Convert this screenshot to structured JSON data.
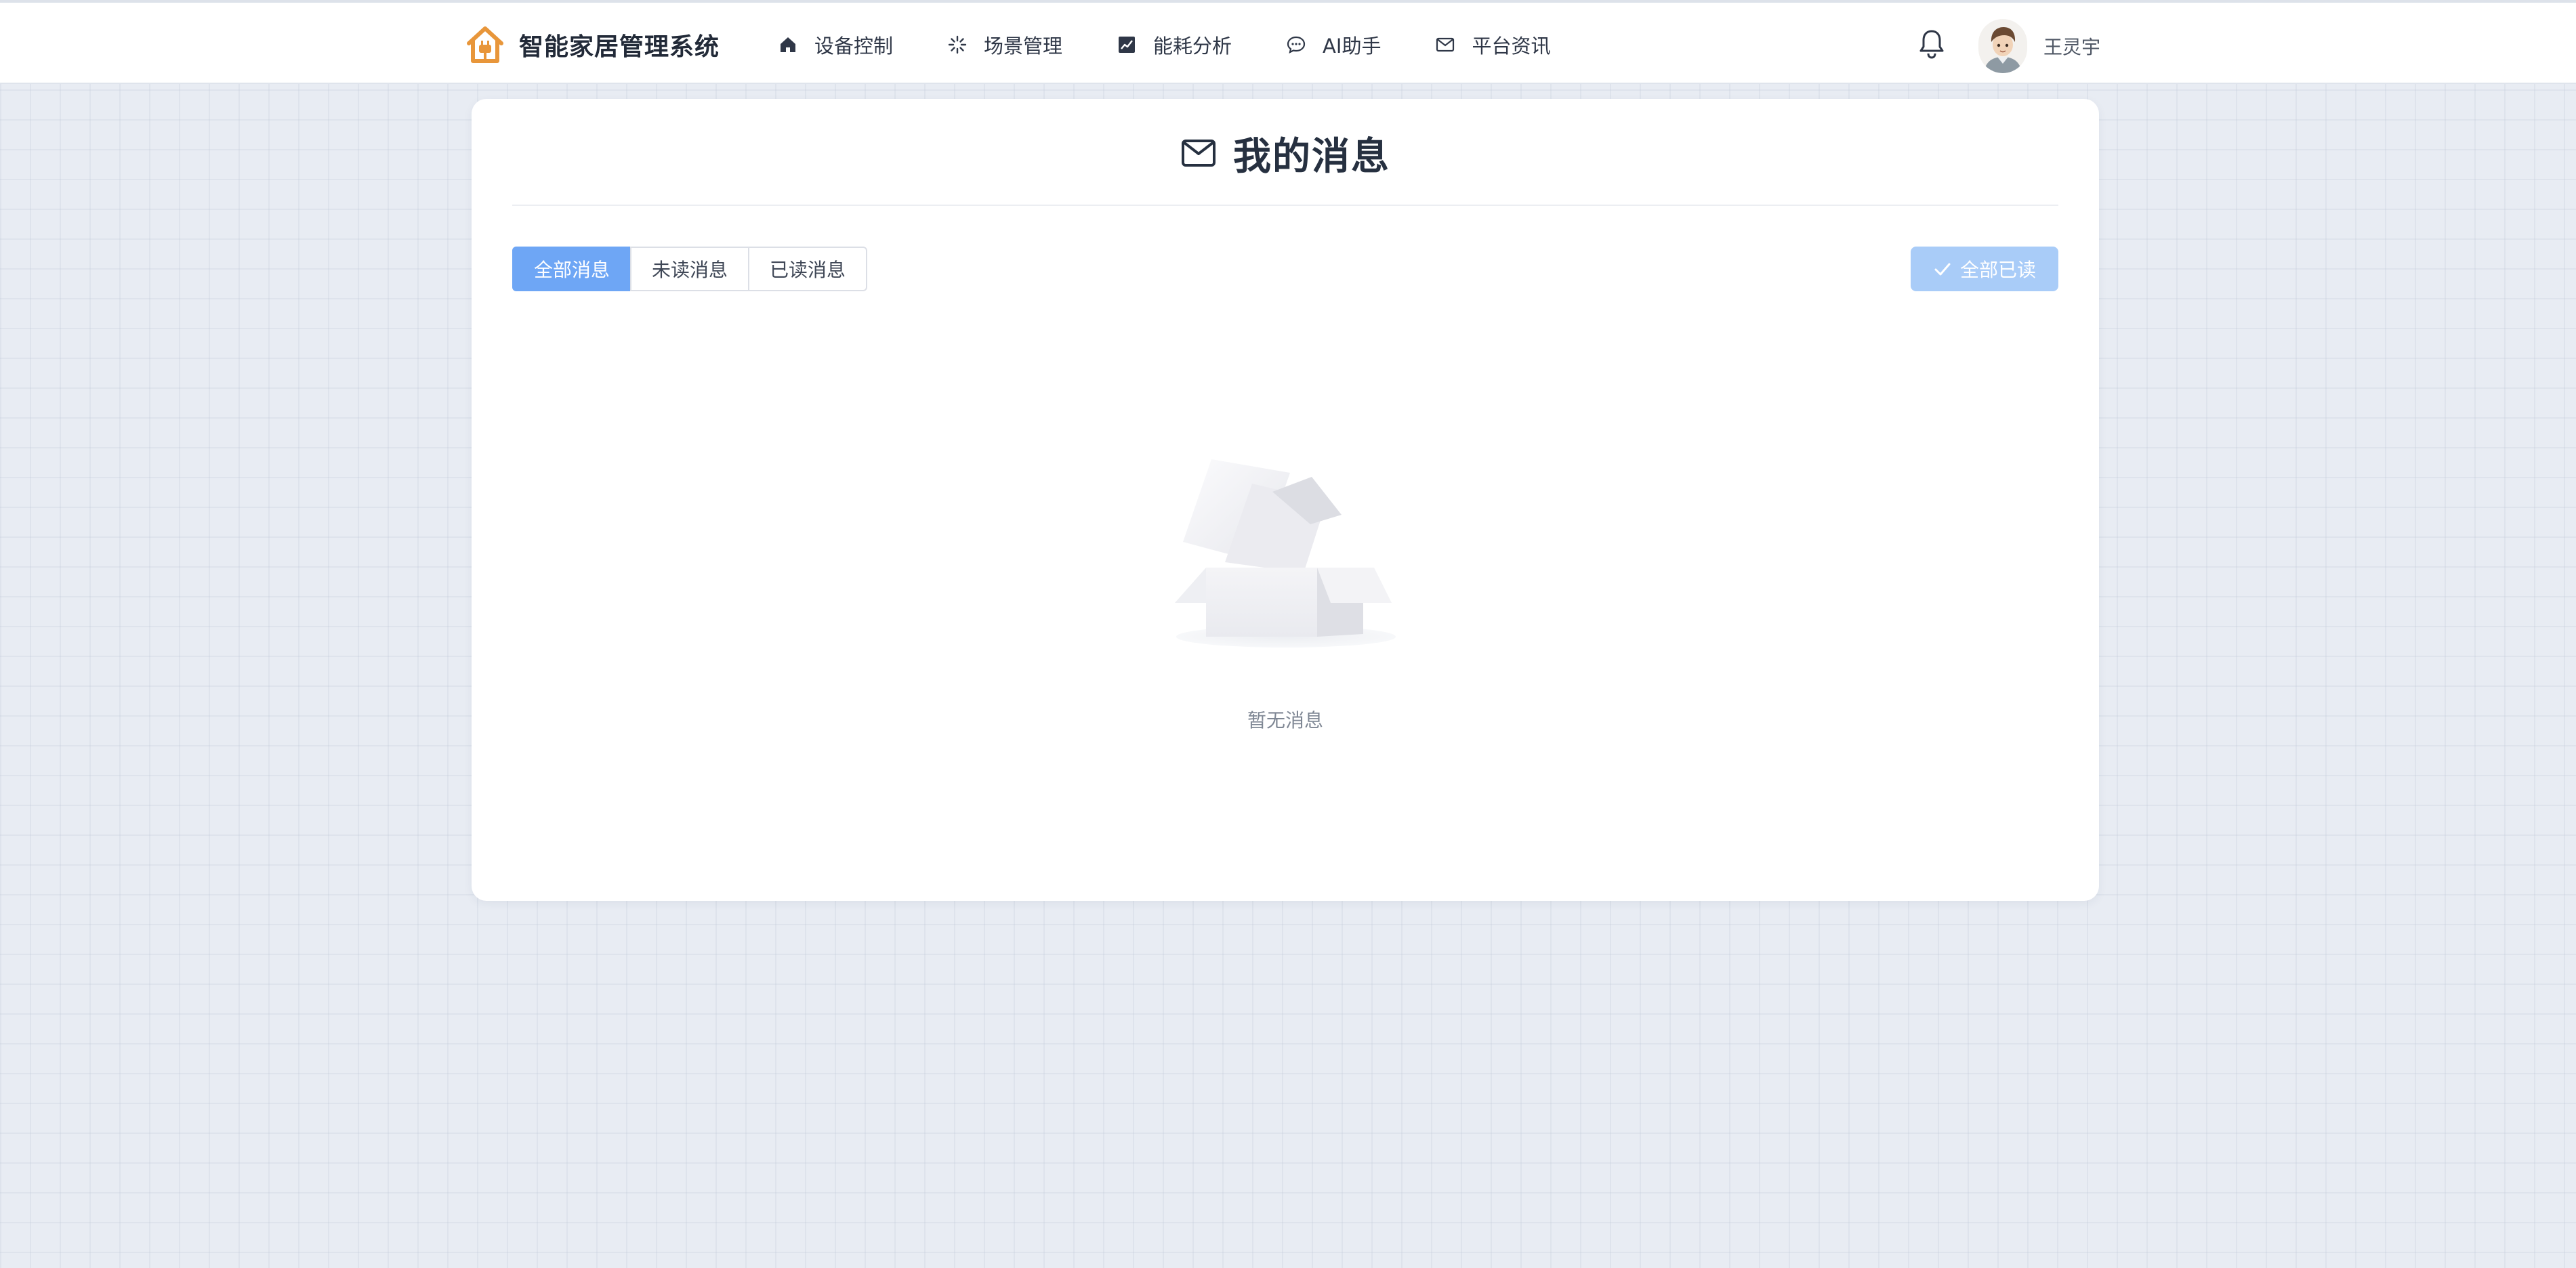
{
  "header": {
    "app_title": "智能家居管理系统",
    "logo_icon": "house-plug-icon",
    "nav": [
      {
        "label": "设备控制",
        "icon": "home-icon"
      },
      {
        "label": "场景管理",
        "icon": "spark-icon"
      },
      {
        "label": "能耗分析",
        "icon": "chart-icon"
      },
      {
        "label": "AI助手",
        "icon": "chat-bubble-icon"
      },
      {
        "label": "平台资讯",
        "icon": "mail-icon"
      }
    ],
    "notification_icon": "bell-icon",
    "user": {
      "name": "王灵宇",
      "avatar": "avatar-icon"
    }
  },
  "page": {
    "title": "我的消息",
    "title_icon": "mail-icon",
    "tabs": [
      {
        "label": "全部消息",
        "active": true
      },
      {
        "label": "未读消息",
        "active": false
      },
      {
        "label": "已读消息",
        "active": false
      }
    ],
    "mark_all_read": {
      "label": "全部已读",
      "icon": "check-icon",
      "disabled": true
    },
    "empty": {
      "text": "暂无消息",
      "illustration": "empty-box-icon"
    }
  },
  "colors": {
    "primary": "#6ea6f5",
    "primary_disabled": "#a9ccf8",
    "brand_orange": "#e8963a",
    "background": "#e8ecf3"
  }
}
